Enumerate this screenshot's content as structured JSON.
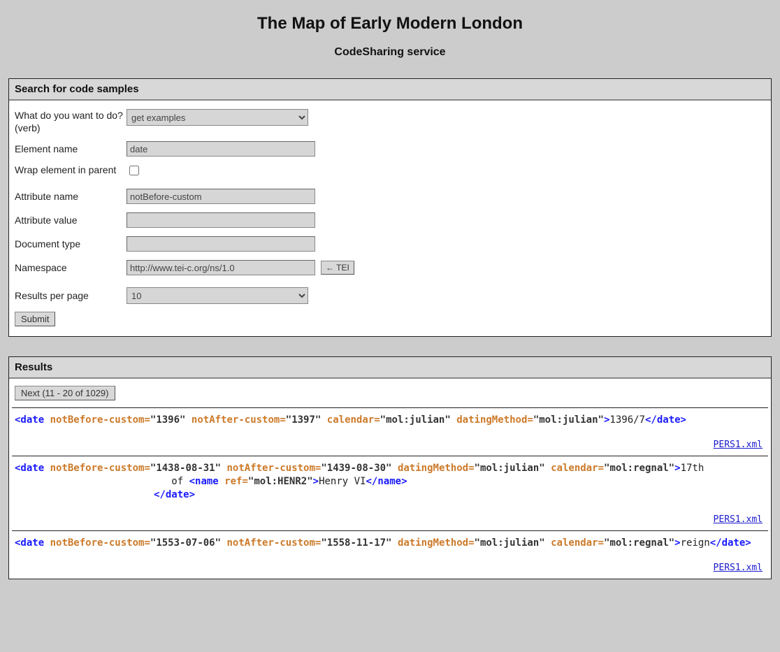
{
  "header": {
    "title": "The Map of Early Modern London",
    "subtitle": "CodeSharing service"
  },
  "search_panel": {
    "heading": "Search for code samples",
    "labels": {
      "verb": "What do you want to do? (verb)",
      "element": "Element name",
      "wrap": "Wrap element in parent",
      "attr_name": "Attribute name",
      "attr_value": "Attribute value",
      "doc_type": "Document type",
      "namespace": "Namespace",
      "per_page": "Results per page"
    },
    "values": {
      "verb_selected": "get examples",
      "element": "date",
      "wrap_checked": false,
      "attr_name": "notBefore-custom",
      "attr_value": "",
      "doc_type": "",
      "namespace": "http://www.tei-c.org/ns/1.0",
      "per_page_selected": "10"
    },
    "buttons": {
      "tei": "← TEI",
      "submit": "Submit"
    }
  },
  "results_panel": {
    "heading": "Results",
    "next_button": "Next (11 - 20 of 1029)",
    "items": [
      {
        "file": "PERS1.xml",
        "tokens": [
          {
            "t": "tag",
            "v": "<date"
          },
          {
            "t": "sp",
            "v": " "
          },
          {
            "t": "attr",
            "v": "notBefore-custom="
          },
          {
            "t": "val",
            "v": "\"1396\""
          },
          {
            "t": "sp",
            "v": " "
          },
          {
            "t": "attr",
            "v": "notAfter-custom="
          },
          {
            "t": "val",
            "v": "\"1397\""
          },
          {
            "t": "sp",
            "v": " "
          },
          {
            "t": "attr",
            "v": "calendar="
          },
          {
            "t": "val",
            "v": "\"mol:julian\""
          },
          {
            "t": "sp",
            "v": " "
          },
          {
            "t": "attr",
            "v": "datingMethod="
          },
          {
            "t": "val",
            "v": "\"mol:julian\""
          },
          {
            "t": "tag",
            "v": ">"
          },
          {
            "t": "txt",
            "v": "1396/7"
          },
          {
            "t": "tag",
            "v": "</date>"
          }
        ]
      },
      {
        "file": "PERS1.xml",
        "tokens": [
          {
            "t": "tag",
            "v": "<date"
          },
          {
            "t": "sp",
            "v": " "
          },
          {
            "t": "attr",
            "v": "notBefore-custom="
          },
          {
            "t": "val",
            "v": "\"1438-08-31\""
          },
          {
            "t": "sp",
            "v": " "
          },
          {
            "t": "attr",
            "v": "notAfter-custom="
          },
          {
            "t": "val",
            "v": "\"1439-08-30\""
          },
          {
            "t": "sp",
            "v": " "
          },
          {
            "t": "attr",
            "v": "datingMethod="
          },
          {
            "t": "val",
            "v": "\"mol:julian\""
          },
          {
            "t": "sp",
            "v": " "
          },
          {
            "t": "attr",
            "v": "calendar="
          },
          {
            "t": "val",
            "v": "\"mol:regnal\""
          },
          {
            "t": "tag",
            "v": ">"
          },
          {
            "t": "txt",
            "v": "17th\n          of "
          },
          {
            "t": "tag",
            "v": "<name"
          },
          {
            "t": "sp",
            "v": " "
          },
          {
            "t": "attr",
            "v": "ref="
          },
          {
            "t": "val",
            "v": "\"mol:HENR2\""
          },
          {
            "t": "tag",
            "v": ">"
          },
          {
            "t": "txt",
            "v": "Henry VI"
          },
          {
            "t": "tag",
            "v": "</name>"
          },
          {
            "t": "txt",
            "v": "\n       "
          },
          {
            "t": "tag",
            "v": "</date>"
          }
        ]
      },
      {
        "file": "PERS1.xml",
        "tokens": [
          {
            "t": "tag",
            "v": "<date"
          },
          {
            "t": "sp",
            "v": " "
          },
          {
            "t": "attr",
            "v": "notBefore-custom="
          },
          {
            "t": "val",
            "v": "\"1553-07-06\""
          },
          {
            "t": "sp",
            "v": " "
          },
          {
            "t": "attr",
            "v": "notAfter-custom="
          },
          {
            "t": "val",
            "v": "\"1558-11-17\""
          },
          {
            "t": "sp",
            "v": " "
          },
          {
            "t": "attr",
            "v": "datingMethod="
          },
          {
            "t": "val",
            "v": "\"mol:julian\""
          },
          {
            "t": "sp",
            "v": " "
          },
          {
            "t": "attr",
            "v": "calendar="
          },
          {
            "t": "val",
            "v": "\"mol:regnal\""
          },
          {
            "t": "tag",
            "v": ">"
          },
          {
            "t": "txt",
            "v": "reign"
          },
          {
            "t": "tag",
            "v": "</date>"
          }
        ]
      }
    ]
  }
}
